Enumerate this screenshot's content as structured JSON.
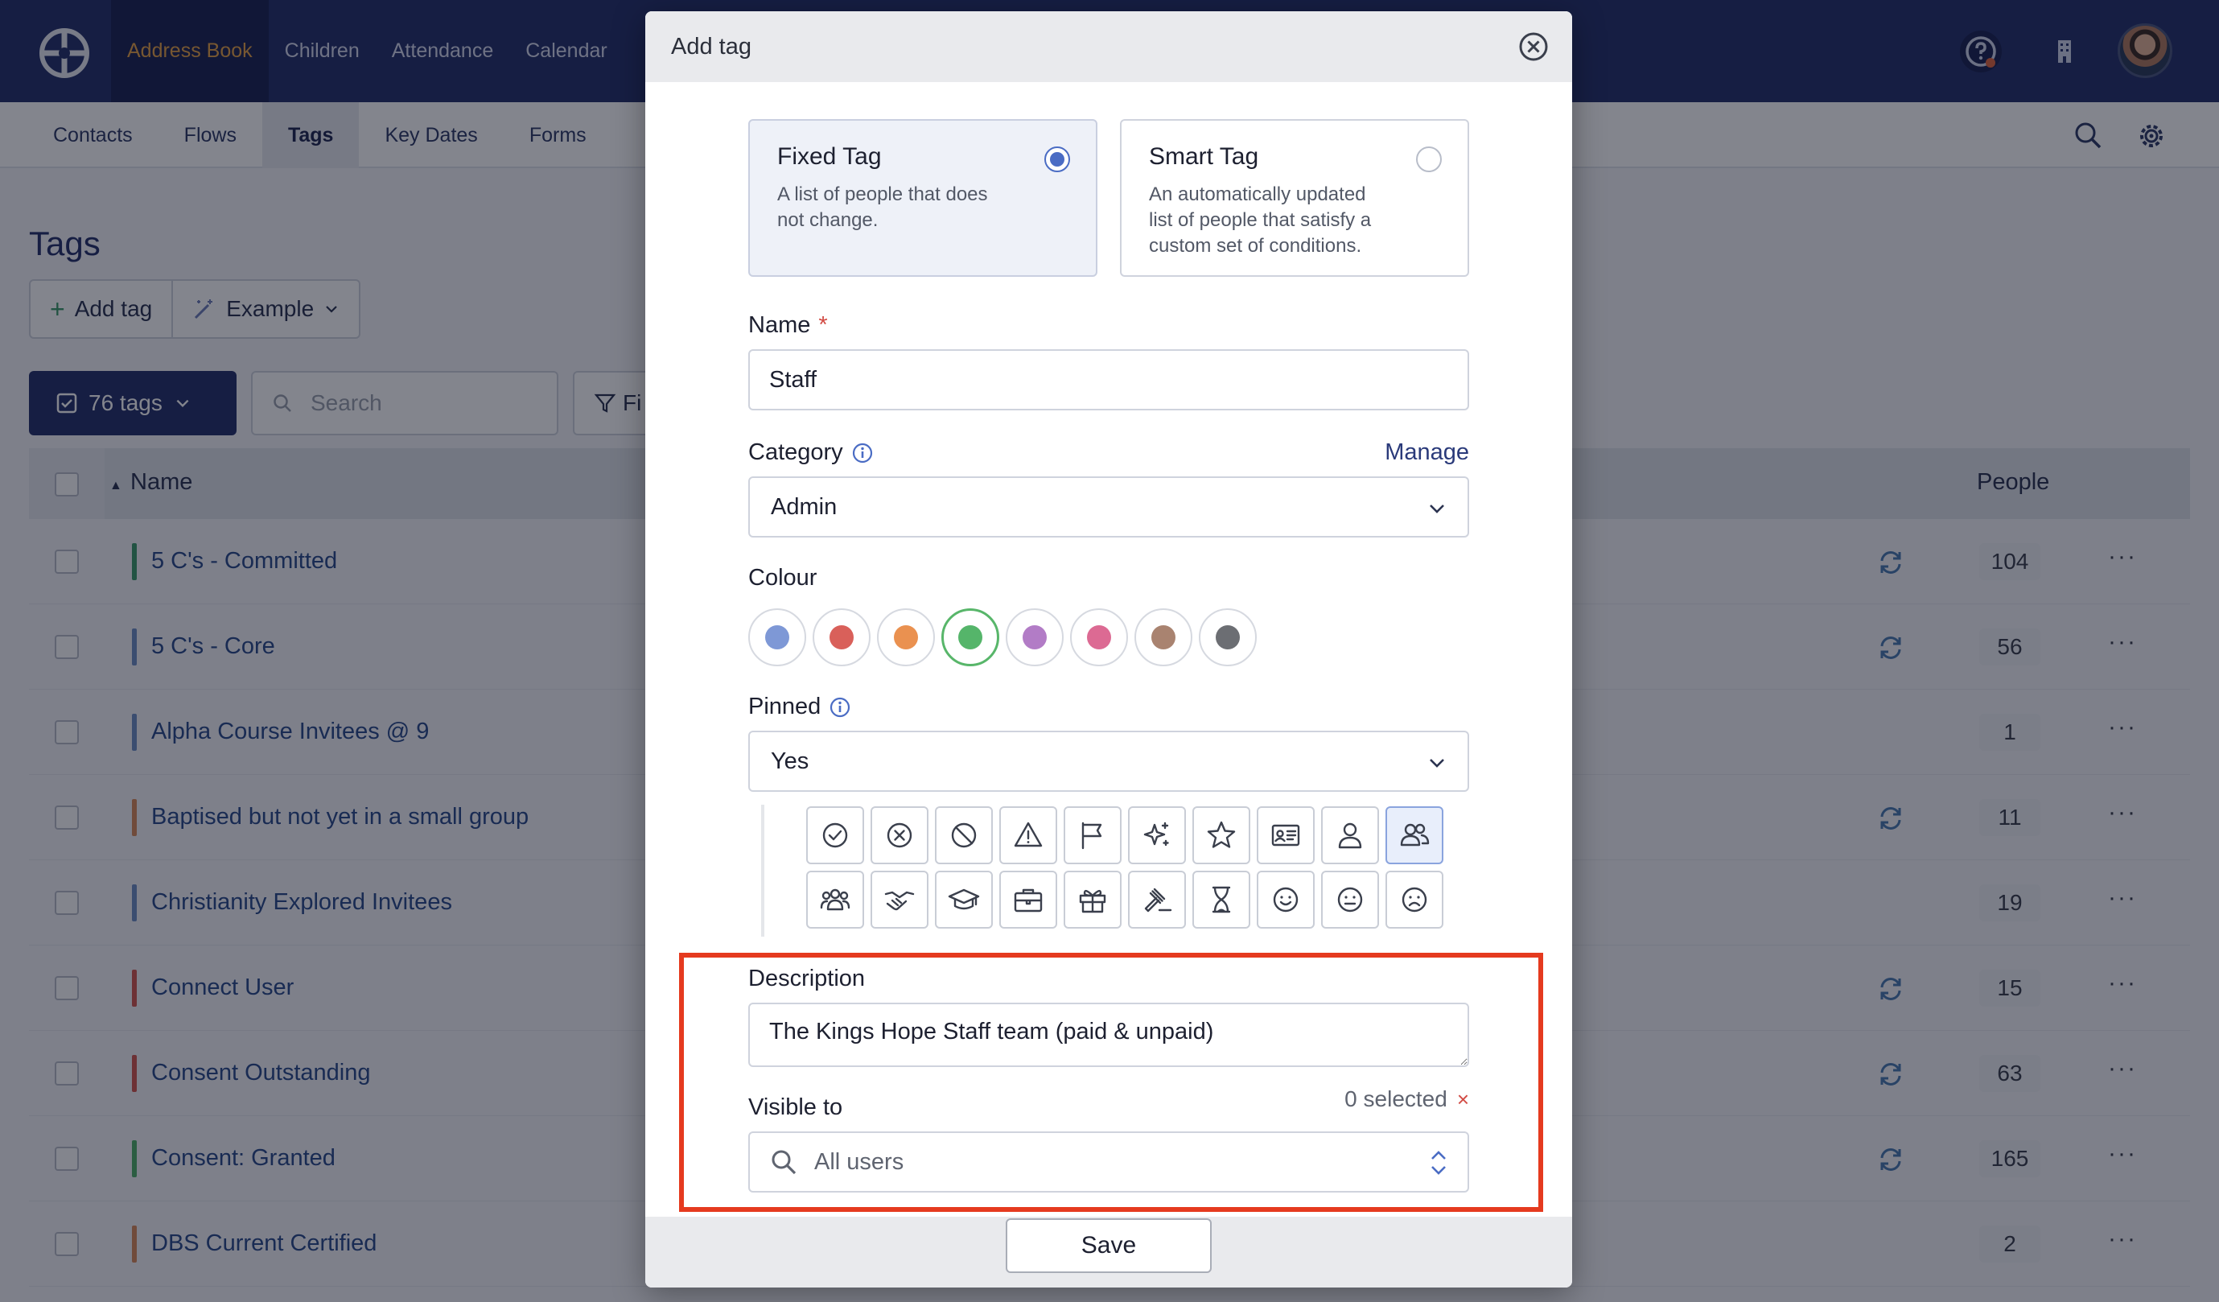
{
  "topnav": {
    "items": [
      "Address Book",
      "Children",
      "Attendance",
      "Calendar"
    ],
    "active_index": 0
  },
  "subnav": {
    "items": [
      "Contacts",
      "Flows",
      "Tags",
      "Key Dates",
      "Forms"
    ],
    "active_index": 2
  },
  "page": {
    "title": "Tags",
    "add_tag_label": "Add tag",
    "example_label": "Example",
    "tag_count_label": "76 tags",
    "search_placeholder": "Search",
    "filter_label": "Fi",
    "columns": {
      "name": "Name",
      "people": "People"
    }
  },
  "rows": [
    {
      "name": "5 C's - Committed",
      "color": "#3d9a6a",
      "count": "104",
      "smart": true
    },
    {
      "name": "5 C's - Core",
      "color": "#6f8fc4",
      "count": "56",
      "smart": true
    },
    {
      "name": "Alpha Course Invitees @ 9",
      "color": "#6f8fc4",
      "count": "1",
      "smart": false
    },
    {
      "name": "Baptised but not yet in a small group",
      "color": "#d98a5a",
      "count": "11",
      "smart": true
    },
    {
      "name": "Christianity Explored Invitees",
      "color": "#6f8fc4",
      "count": "19",
      "smart": false
    },
    {
      "name": "Connect User",
      "color": "#d2574f",
      "count": "15",
      "smart": true
    },
    {
      "name": "Consent Outstanding",
      "color": "#d2574f",
      "count": "63",
      "smart": true
    },
    {
      "name": "Consent: Granted",
      "color": "#4fae68",
      "count": "165",
      "smart": true
    },
    {
      "name": "DBS Current Certified",
      "color": "#d98a5a",
      "count": "2",
      "smart": false
    }
  ],
  "modal": {
    "title": "Add tag",
    "fixed": {
      "title": "Fixed Tag",
      "desc": "A list of people that does not change.",
      "selected": true
    },
    "smart": {
      "title": "Smart Tag",
      "desc": "An automatically updated list of people that satisfy a custom set of conditions.",
      "selected": false
    },
    "name_label": "Name",
    "required_mark": "*",
    "name_value": "Staff",
    "category_label": "Category",
    "manage_label": "Manage",
    "category_value": "Admin",
    "colour_label": "Colour",
    "colours": [
      "#7e98d6",
      "#d9605a",
      "#ea9150",
      "#55b56a",
      "#b27cc6",
      "#dc6a93",
      "#a98370",
      "#6c6e73"
    ],
    "selected_colour_index": 3,
    "pinned_label": "Pinned",
    "pinned_value": "Yes",
    "icons": [
      "check-circle-icon",
      "x-circle-icon",
      "ban-icon",
      "warning-icon",
      "flag-icon",
      "sparkles-icon",
      "star-icon",
      "id-card-icon",
      "user-icon",
      "users-icon",
      "group-icon",
      "handshake-icon",
      "graduation-cap-icon",
      "briefcase-icon",
      "gift-icon",
      "gavel-icon",
      "hourglass-icon",
      "smile-icon",
      "neutral-face-icon",
      "frown-icon"
    ],
    "selected_icon_index": 9,
    "description_label": "Description",
    "description_value": "The Kings Hope Staff team (paid & unpaid)",
    "visible_label": "Visible to",
    "visible_count": "0 selected",
    "visible_clear": "×",
    "visible_value": "All users",
    "save_label": "Save"
  }
}
